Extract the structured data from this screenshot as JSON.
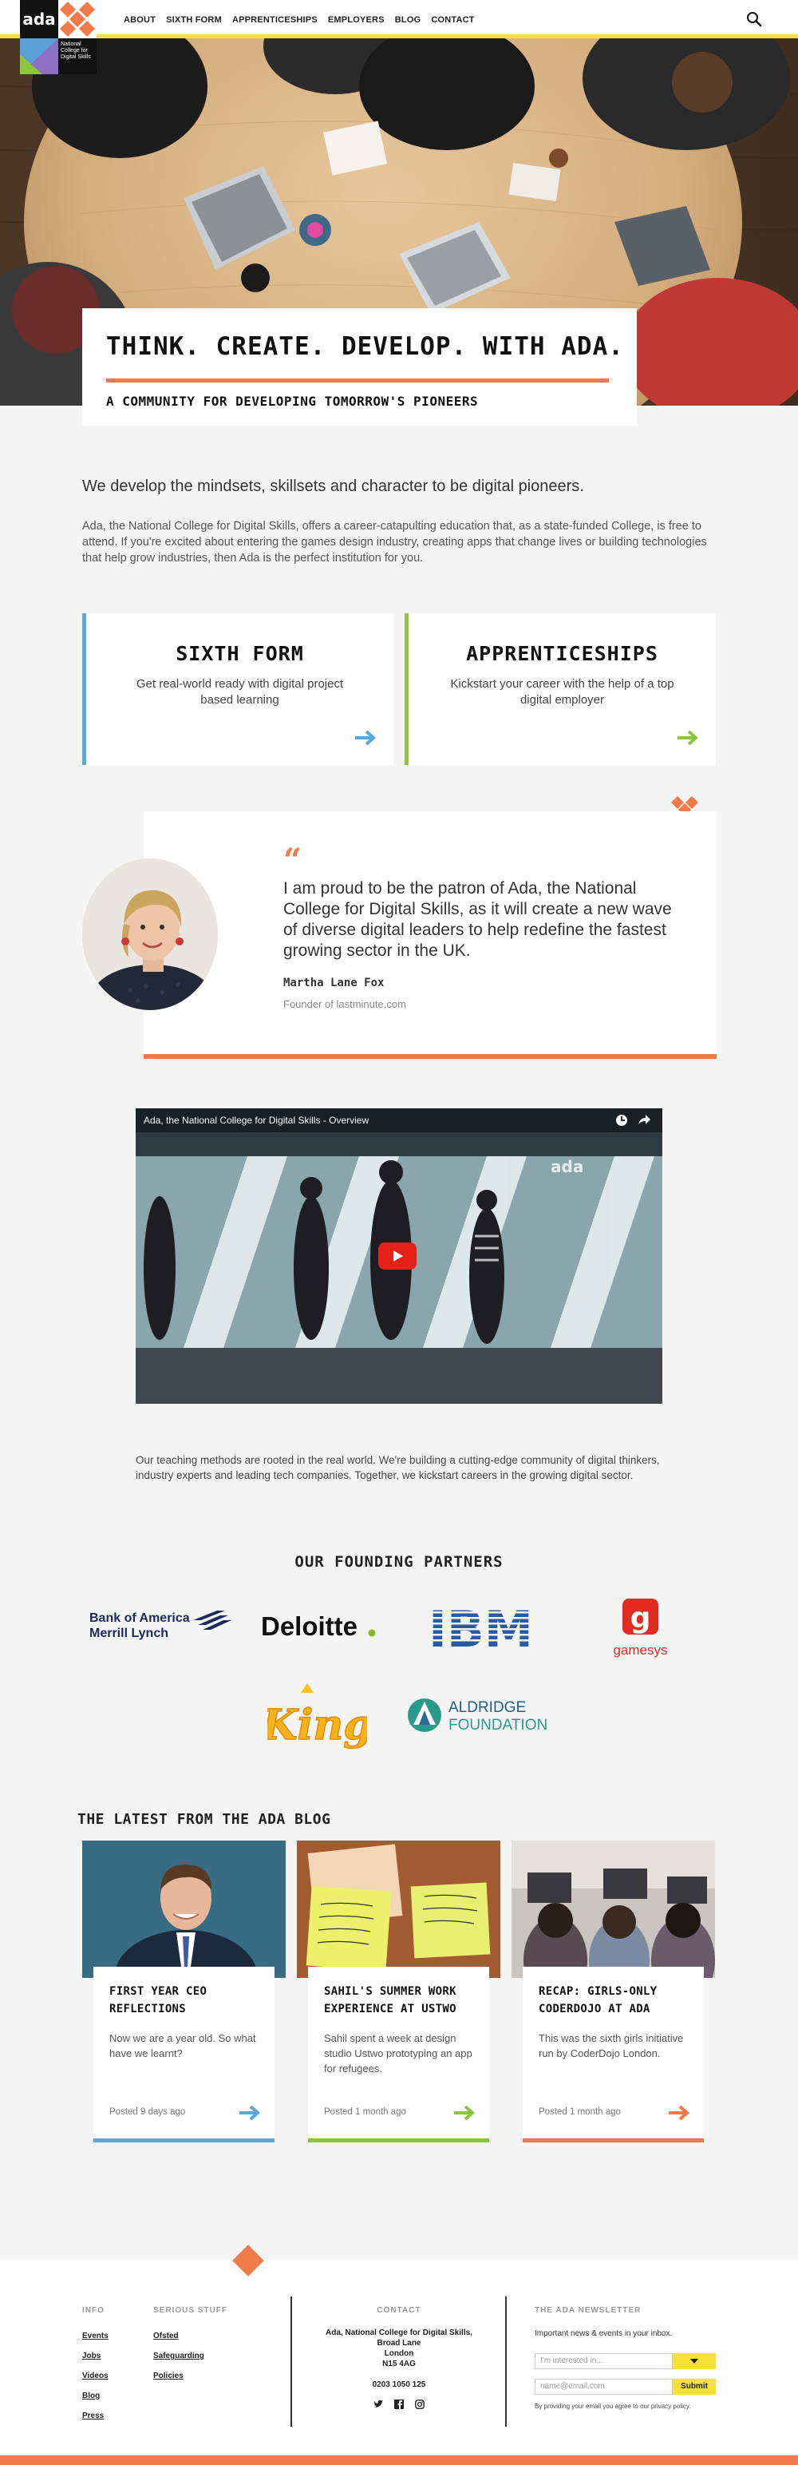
{
  "brand": {
    "logo_word": "ada",
    "logo_tagline": "National College for Digital Skills",
    "accent_orange": "#f07a4a",
    "accent_yellow": "#f5e13a",
    "accent_blue": "#58a9da",
    "accent_green": "#8cc63f"
  },
  "nav": {
    "items": [
      "ABOUT",
      "SIXTH FORM",
      "APPRENTICESHIPS",
      "EMPLOYERS",
      "BLOG",
      "CONTACT"
    ],
    "search_icon": "search-icon"
  },
  "hero": {
    "title": "THINK. CREATE. DEVELOP. WITH ADA.",
    "subtitle": "A COMMUNITY FOR DEVELOPING TOMORROW'S PIONEERS"
  },
  "intro": {
    "lead": "We develop the mindsets, skillsets and character to be digital pioneers.",
    "body": "Ada, the National College for Digital Skills, offers a career-catapulting education that, as a state-funded College, is free to attend. If you're excited about entering the games design industry, creating apps that change lives or building technologies that help grow industries, then Ada is the perfect institution for you."
  },
  "cards": [
    {
      "title": "SIXTH FORM",
      "text": "Get real-world ready with digital project based learning"
    },
    {
      "title": "APPRENTICESHIPS",
      "text": "Kickstart your career with the help of a top digital employer"
    }
  ],
  "testimonial": {
    "quote": "I am proud to be the patron of Ada, the National College for Digital Skills, as it will create a new wave of diverse digital leaders to help redefine the fastest growing sector in the UK.",
    "name": "Martha Lane Fox",
    "role": "Founder of lastminute.com"
  },
  "video": {
    "title": "Ada, the National College for Digital Skills - Overview",
    "overlay_word": "ada"
  },
  "teaching": "Our teaching methods are rooted in the real world. We're building a cutting-edge community of digital thinkers, industry experts and leading tech companies. Together, we kickstart careers in the growing digital sector.",
  "partners": {
    "title": "OUR FOUNDING PARTNERS",
    "logos": {
      "boa_line1": "Bank of America",
      "boa_line2": "Merrill Lynch",
      "deloitte": "Deloitte",
      "deloitte_dot": ".",
      "ibm": "IBM",
      "gamesys_letter": "g",
      "gamesys": "gamesys",
      "king": "King",
      "aldridge_line1": "ALDRIDGE",
      "aldridge_line2": "FOUNDATION"
    }
  },
  "blog": {
    "title": "THE LATEST FROM THE ADA BLOG",
    "posts": [
      {
        "title": "FIRST YEAR CEO REFLECTIONS",
        "excerpt": "Now we are a year old. So what have we learnt?",
        "meta": "Posted 9 days ago",
        "color": "#58a9da"
      },
      {
        "title": "SAHIL'S SUMMER WORK EXPERIENCE AT USTWO",
        "excerpt": "Sahil spent a week at design studio Ustwo prototyping an app for refugees.",
        "meta": "Posted 1 month ago",
        "color": "#8cc63f"
      },
      {
        "title": "RECAP: GIRLS-ONLY CODERDOJO AT ADA",
        "excerpt": "This was the sixth girls initiative run by CoderDojo London.",
        "meta": "Posted 1 month ago",
        "color": "#f07a4a"
      }
    ]
  },
  "footer": {
    "info_title": "INFO",
    "info_links": [
      "Events",
      "Jobs",
      "Videos",
      "Blog",
      "Press"
    ],
    "serious_title": "SERIOUS STUFF",
    "serious_links": [
      "Ofsted",
      "Safeguarding",
      "Policies"
    ],
    "contact_title": "CONTACT",
    "contact_lines": [
      "Ada, National College for Digital Skills,",
      "Broad Lane",
      "London",
      "N15 4AG"
    ],
    "phone": "0203 1050 125",
    "social_icons": [
      "twitter-icon",
      "facebook-icon",
      "instagram-icon"
    ],
    "newsletter_title": "THE ADA NEWSLETTER",
    "newsletter_text": "Important news & events in your inbox.",
    "interest_placeholder": "I'm interested in...",
    "email_placeholder": "name@email.com",
    "submit_label": "Submit",
    "privacy_note": "By providing your email you agree to our privacy policy."
  }
}
